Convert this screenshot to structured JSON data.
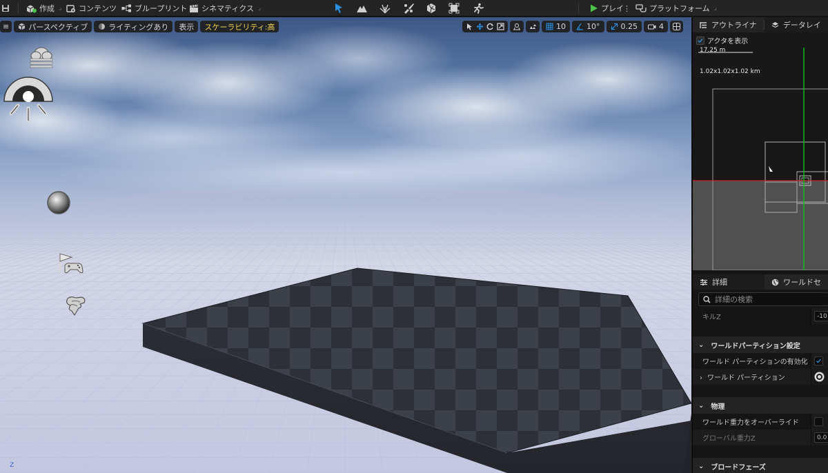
{
  "toolbar": {
    "create": "作成",
    "content": "コンテンツ",
    "blueprint": "ブループリント",
    "cinematics": "シネマティクス",
    "play": "プレイ",
    "platform": "プラットフォーム"
  },
  "viewport": {
    "perspective": "パースペクティブ",
    "lighting": "ライティングあり",
    "show": "表示",
    "scalability": "スケーラビリティ:高",
    "grid_snap": "10",
    "rotation_snap": "10°",
    "scale_snap": "0.25",
    "camera_speed": "4",
    "axis_label": "Z"
  },
  "outliner": {
    "tab_outliner": "アウトライナ",
    "tab_data_layers": "データレイ",
    "show_actors": "アクタを表示",
    "scale_label": "17.25 m",
    "extent_label": "1.02x1.02x1.02 km"
  },
  "details": {
    "tab_details": "詳細",
    "tab_world_settings": "ワールドセ",
    "search_placeholder": "詳細の検索",
    "kill_z_label": "キルZ",
    "kill_z_value": "-10",
    "category_world_partition": "ワールドパーティション設定",
    "enable_world_partition": "ワールド パーティションの有効化",
    "world_partition": "ワールド パーティション",
    "category_physics": "物理",
    "override_world_gravity": "ワールド重力をオーバーライド",
    "global_gravity_z": "グローバル重力Z",
    "global_gravity_z_value": "0.0",
    "category_broadphase": "ブロードフェーズ"
  },
  "colors": {
    "accent_yellow": "#f2d34a",
    "play_green": "#4cc24a",
    "axis_green": "#19c219",
    "axis_red": "#c82424",
    "select_blue": "#2a8fe0"
  }
}
